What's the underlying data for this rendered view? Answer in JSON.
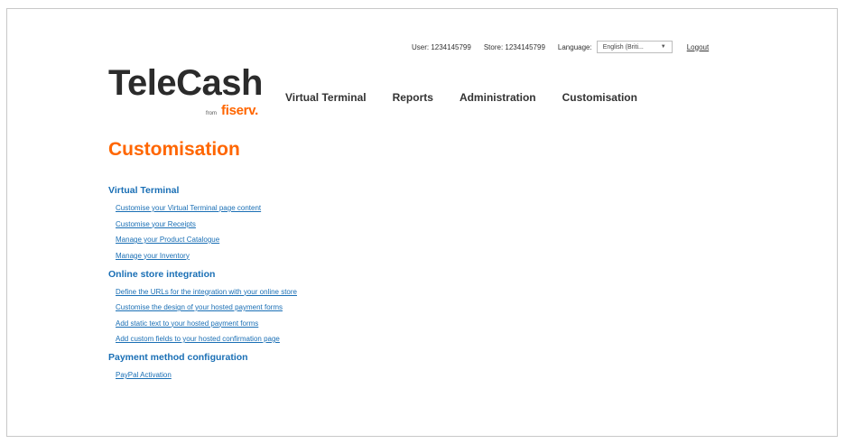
{
  "header": {
    "user_label": "User: 1234145799",
    "store_label": "Store: 1234145799",
    "language_label": "Language:",
    "language_value": "English (Briti...",
    "logout": "Logout"
  },
  "logo": {
    "name": "TeleCash",
    "from": "from",
    "brand": "fiserv."
  },
  "nav": [
    {
      "label": "Virtual Terminal"
    },
    {
      "label": "Reports"
    },
    {
      "label": "Administration"
    },
    {
      "label": "Customisation"
    }
  ],
  "page": {
    "title": "Customisation"
  },
  "sections": [
    {
      "title": "Virtual Terminal",
      "links": [
        "Customise your Virtual Terminal page content",
        "Customise your Receipts",
        "Manage your Product Catalogue",
        "Manage your Inventory"
      ]
    },
    {
      "title": "Online store integration",
      "links": [
        "Define the URLs for the integration with your online store",
        "Customise the design of your hosted payment forms",
        "Add static text to your hosted payment forms",
        "Add custom fields to your hosted confirmation page"
      ]
    },
    {
      "title": "Payment method configuration",
      "links": [
        "PayPal Activation"
      ]
    }
  ],
  "colors": {
    "accent_orange": "#ff6600",
    "link_blue": "#1a6fb5"
  }
}
